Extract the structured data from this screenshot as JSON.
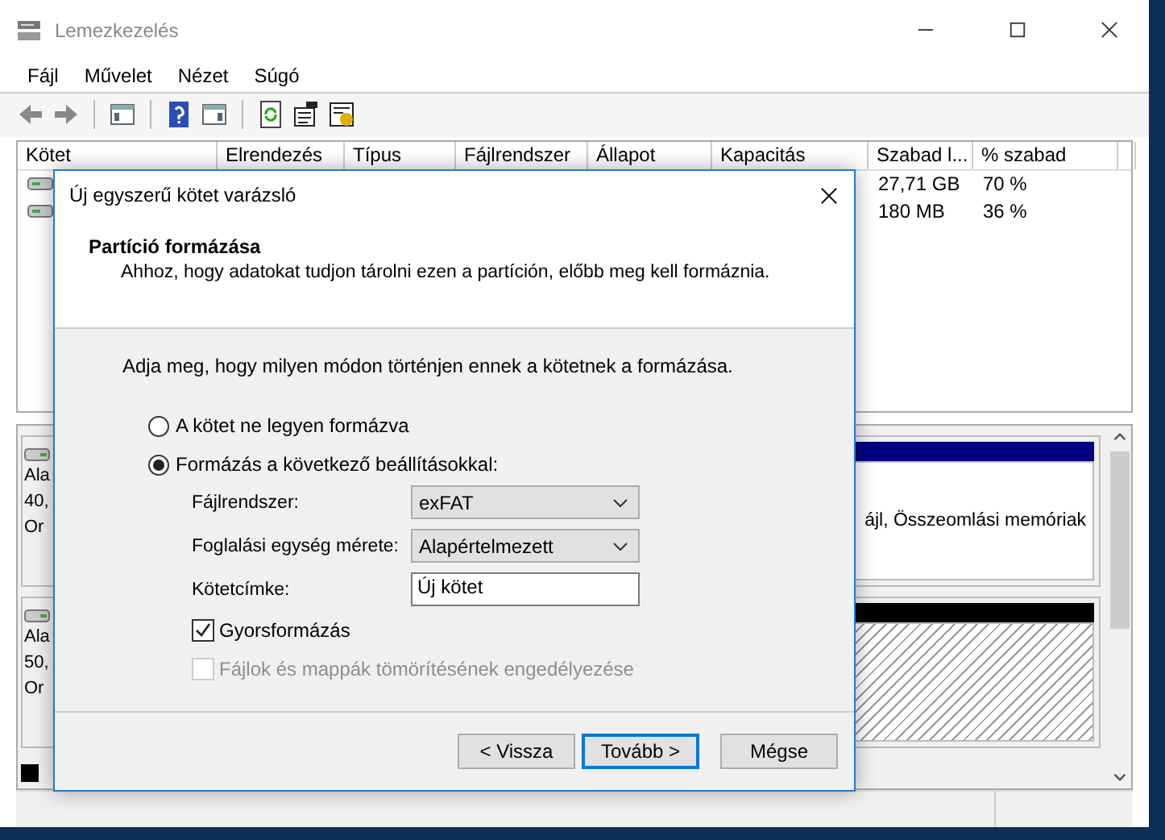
{
  "window": {
    "title": "Lemezkezelés"
  },
  "menu": [
    "Fájl",
    "Művelet",
    "Nézet",
    "Súgó"
  ],
  "table": {
    "columns": [
      "Kötet",
      "Elrendezés",
      "Típus",
      "Fájlrendszer",
      "Állapot",
      "Kapacitás",
      "Szabad l...",
      "% szabad"
    ],
    "rows": [
      {
        "free_space": "27,71 GB",
        "percent_free": "70 %"
      },
      {
        "free_space": "180 MB",
        "percent_free": "36 %"
      }
    ]
  },
  "disks": [
    {
      "lines": [
        "Ala",
        "40,",
        "Or"
      ],
      "partition": {
        "kind": "primary",
        "text": "ájl, Összeomlási memóriak"
      }
    },
    {
      "lines": [
        "Ala",
        "50,",
        "Or"
      ],
      "partition": {
        "kind": "unallocated"
      }
    }
  ],
  "legend": [
    {
      "color": "#000000"
    }
  ],
  "dialog": {
    "title": "Új egyszerű kötet varázsló",
    "heading": "Partíció formázása",
    "subtitle": "Ahhoz, hogy adatokat tudjon tárolni ezen a partíción, előbb meg kell formáznia.",
    "instruction": "Adja meg, hogy milyen módon történjen ennek a kötetnek a formázása.",
    "options": [
      {
        "label": "A kötet ne legyen formázva",
        "selected": false
      },
      {
        "label": "Formázás a következő beállításokkal:",
        "selected": true
      }
    ],
    "fields": [
      {
        "kind": "select",
        "label": "Fájlrendszer:",
        "value": "exFAT"
      },
      {
        "kind": "select",
        "label": "Foglalási egység mérete:",
        "value": "Alapértelmezett"
      },
      {
        "kind": "text",
        "label": "Kötetcímke:",
        "value": "Új kötet"
      }
    ],
    "checkboxes": [
      {
        "label": "Gyorsformázás",
        "checked": true,
        "disabled": false
      },
      {
        "label": "Fájlok és mappák tömörítésének engedélyezése",
        "checked": false,
        "disabled": true
      }
    ],
    "buttons": [
      {
        "label": "< Vissza",
        "default": false
      },
      {
        "label": "Tovább >",
        "default": true
      },
      {
        "label": "Mégse",
        "default": false
      }
    ]
  }
}
